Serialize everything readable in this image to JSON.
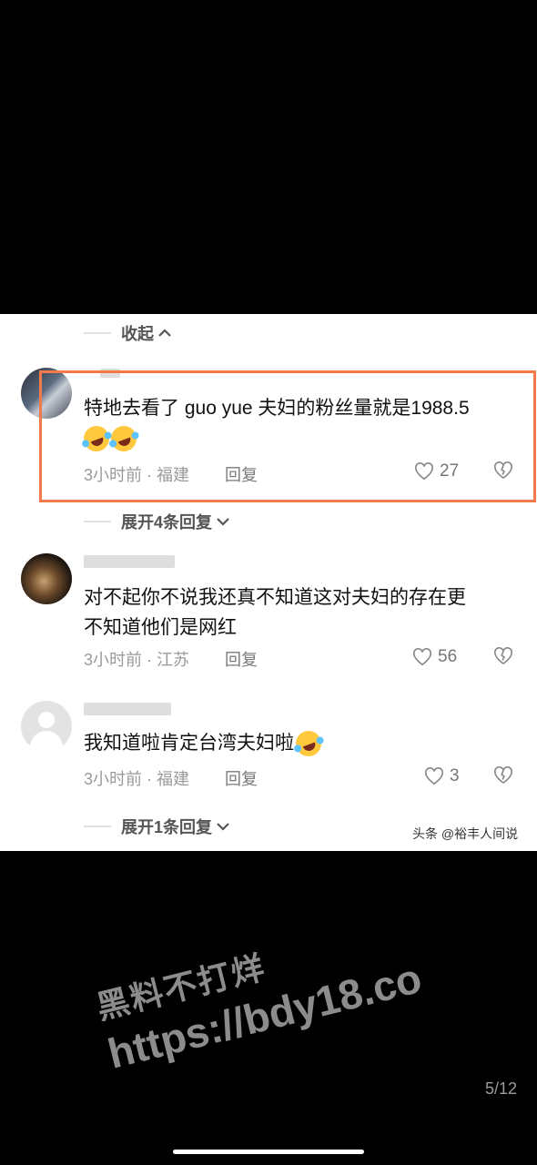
{
  "collapse": {
    "label": "收起",
    "chevron": "chevron-up-icon"
  },
  "comments": [
    {
      "text": "特地去看了 guo yue 夫妇的粉丝量就是1988.5",
      "emojis": [
        "rofl-emoji",
        "rofl-emoji"
      ],
      "time": "3小时前",
      "location": "福建",
      "reply_label": "回复",
      "likes": "27",
      "expand_label": "展开4条回复"
    },
    {
      "text_line1": "对不起你不说我还真不知道这对夫妇的存在更",
      "text_line2": "不知道他们是网红",
      "time": "3小时前",
      "location": "江苏",
      "reply_label": "回复",
      "likes": "56"
    },
    {
      "text": "我知道啦肯定台湾夫妇啦",
      "emojis": [
        "rofl-emoji"
      ],
      "time": "3小时前",
      "location": "福建",
      "reply_label": "回复",
      "likes": "3",
      "expand_label": "展开1条回复"
    }
  ],
  "source_credit": "头条 @裕丰人间说",
  "watermark": {
    "line1": "黑料不打烊",
    "line2": "https://bdy18.co"
  },
  "pager": "5/12",
  "colors": {
    "highlight": "#f07a4a",
    "background": "#000000",
    "panel": "#ffffff"
  }
}
